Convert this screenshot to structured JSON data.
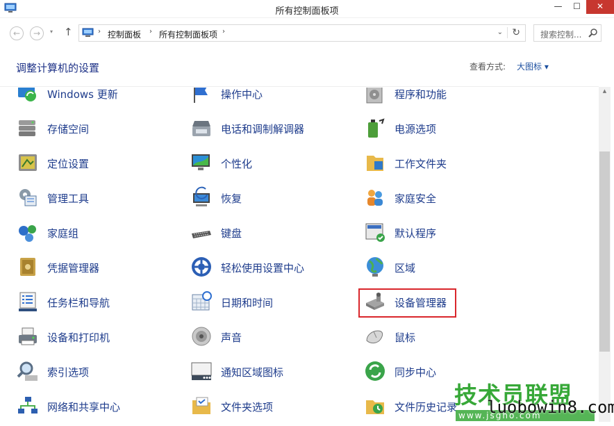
{
  "window": {
    "title": "所有控制面板项"
  },
  "nav": {
    "back_label": "←",
    "forward_label": "→",
    "recent_label": "▾",
    "up_label": "↑",
    "breadcrumb": [
      "控制面板",
      "所有控制面板项"
    ],
    "breadcrumb_sep": "›",
    "dropdown_label": "⌄",
    "refresh_label": "↻",
    "search_placeholder": "搜索控制..."
  },
  "header": {
    "title": "调整计算机的设置",
    "view_label": "查看方式:",
    "view_value": "大图标 ▾"
  },
  "items": [
    {
      "label": "Windows 更新",
      "icon": "windows-update-icon"
    },
    {
      "label": "操作中心",
      "icon": "action-center-flag-icon"
    },
    {
      "label": "程序和功能",
      "icon": "programs-features-icon"
    },
    {
      "label": "存储空间",
      "icon": "storage-spaces-icon"
    },
    {
      "label": "电话和调制解调器",
      "icon": "phone-modem-icon"
    },
    {
      "label": "电源选项",
      "icon": "power-options-icon"
    },
    {
      "label": "定位设置",
      "icon": "location-settings-icon"
    },
    {
      "label": "个性化",
      "icon": "personalization-icon"
    },
    {
      "label": "工作文件夹",
      "icon": "work-folders-icon"
    },
    {
      "label": "管理工具",
      "icon": "admin-tools-icon"
    },
    {
      "label": "恢复",
      "icon": "recovery-icon"
    },
    {
      "label": "家庭安全",
      "icon": "family-safety-icon"
    },
    {
      "label": "家庭组",
      "icon": "homegroup-icon"
    },
    {
      "label": "键盘",
      "icon": "keyboard-icon"
    },
    {
      "label": "默认程序",
      "icon": "default-programs-icon"
    },
    {
      "label": "凭据管理器",
      "icon": "credential-manager-icon"
    },
    {
      "label": "轻松使用设置中心",
      "icon": "ease-of-access-icon"
    },
    {
      "label": "区域",
      "icon": "region-globe-icon"
    },
    {
      "label": "任务栏和导航",
      "icon": "taskbar-navigation-icon"
    },
    {
      "label": "日期和时间",
      "icon": "date-time-icon"
    },
    {
      "label": "设备管理器",
      "icon": "device-manager-icon"
    },
    {
      "label": "设备和打印机",
      "icon": "devices-printers-icon"
    },
    {
      "label": "声音",
      "icon": "sound-speaker-icon"
    },
    {
      "label": "鼠标",
      "icon": "mouse-icon"
    },
    {
      "label": "索引选项",
      "icon": "indexing-options-icon"
    },
    {
      "label": "通知区域图标",
      "icon": "notification-area-icon"
    },
    {
      "label": "同步中心",
      "icon": "sync-center-icon"
    },
    {
      "label": "网络和共享中心",
      "icon": "network-sharing-icon"
    },
    {
      "label": "文件夹选项",
      "icon": "folder-options-icon"
    },
    {
      "label": "文件历史记录",
      "icon": "file-history-icon"
    }
  ],
  "highlighted_item": "设备管理器",
  "watermark": {
    "title": "技术员联盟",
    "url": "luobowin8.com",
    "sub": "www.jsgho.com"
  },
  "colors": {
    "link": "#1e3c8c",
    "title": "#1e3287",
    "highlight_border": "#d9262b",
    "close_button": "#c7372f",
    "watermark_green": "#37a838"
  }
}
